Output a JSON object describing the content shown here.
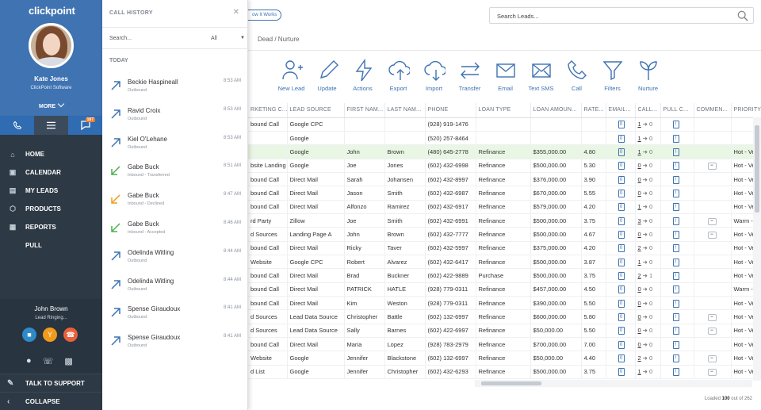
{
  "app": {
    "logo": "clickpoint"
  },
  "user": {
    "name": "Kate Jones",
    "company": "ClickPoint Software",
    "more_label": "MORE"
  },
  "tabs": {
    "leads_badge": "187"
  },
  "nav": [
    {
      "label": "HOME",
      "icon": "home-icon"
    },
    {
      "label": "CALENDAR",
      "icon": "calendar-icon"
    },
    {
      "label": "MY LEADS",
      "icon": "leads-icon"
    },
    {
      "label": "PRODUCTS",
      "icon": "products-icon"
    },
    {
      "label": "REPORTS",
      "icon": "reports-icon"
    },
    {
      "label": "PULL",
      "icon": "pull-icon"
    }
  ],
  "active_call": {
    "caller": "John Brown",
    "status": "Lead Ringing..."
  },
  "footer": {
    "support_label": "TALK TO SUPPORT",
    "collapse_label": "COLLAPSE"
  },
  "call_history": {
    "title": "CALL HISTORY",
    "search_placeholder": "Search...",
    "filter": "All",
    "section": "TODAY",
    "items": [
      {
        "name": "Beckie Haspineall",
        "status": "Outbound",
        "time": "8:53 AM",
        "type": "outbound"
      },
      {
        "name": "Ravid Croix",
        "status": "Outbound",
        "time": "8:53 AM",
        "type": "outbound"
      },
      {
        "name": "Kiel O'Lehane",
        "status": "Outbound",
        "time": "8:53 AM",
        "type": "outbound"
      },
      {
        "name": "Gabe Buck",
        "status": "Inbound - Transferred",
        "time": "8:51 AM",
        "type": "inbound-green"
      },
      {
        "name": "Gabe Buck",
        "status": "Inbound - Declined",
        "time": "8:47 AM",
        "type": "inbound-orange"
      },
      {
        "name": "Gabe Buck",
        "status": "Inbound - Accepted",
        "time": "8:46 AM",
        "type": "inbound-green"
      },
      {
        "name": "Odelinda Witling",
        "status": "Outbound",
        "time": "8:44 AM",
        "type": "outbound"
      },
      {
        "name": "Odelinda Witling",
        "status": "Outbound",
        "time": "8:44 AM",
        "type": "outbound"
      },
      {
        "name": "Spense Giraudoux",
        "status": "Outbound",
        "time": "8:41 AM",
        "type": "outbound"
      },
      {
        "name": "Spense Giraudoux",
        "status": "Outbound",
        "time": "8:41 AM",
        "type": "outbound"
      }
    ]
  },
  "header": {
    "how_it_works": "ow It Works",
    "search_placeholder": "Search Leads...",
    "breadcrumb": "Dead / Nurture"
  },
  "toolbar": [
    {
      "label": "New Lead",
      "icon": "new-lead-icon"
    },
    {
      "label": "Update",
      "icon": "update-icon"
    },
    {
      "label": "Actions",
      "icon": "actions-icon"
    },
    {
      "label": "Export",
      "icon": "export-icon"
    },
    {
      "label": "Import",
      "icon": "import-icon"
    },
    {
      "label": "Transfer",
      "icon": "transfer-icon"
    },
    {
      "label": "Email",
      "icon": "email-icon"
    },
    {
      "label": "Text SMS",
      "icon": "sms-icon"
    },
    {
      "label": "Call",
      "icon": "call-icon"
    },
    {
      "label": "Filters",
      "icon": "filters-icon"
    },
    {
      "label": "Nurture",
      "icon": "nurture-icon"
    }
  ],
  "table": {
    "columns": [
      "RKETING C...",
      "LEAD SOURCE",
      "FIRST NAM...",
      "LAST NAM...",
      "PHONE",
      "LOAN TYPE",
      "LOAN AMOUN...",
      "RATE...",
      "EMAIL...",
      "CALL...",
      "PULL C...",
      "COMMEN...",
      "PRIORITY..."
    ],
    "rows": [
      {
        "mkt": "bound Call",
        "src": "Google CPC",
        "first": "",
        "last": "",
        "phone": "(928) 919-1476",
        "type": "",
        "amount": "",
        "rate": "",
        "email": "0",
        "calls": "1",
        "calls_b": "0",
        "comment": false,
        "priority": ""
      },
      {
        "mkt": "",
        "src": "Google",
        "first": "",
        "last": "",
        "phone": "(520) 257-8464",
        "type": "",
        "amount": "",
        "rate": "",
        "email": "0",
        "calls": "1",
        "calls_b": "0",
        "comment": false,
        "priority": ""
      },
      {
        "mkt": "",
        "src": "Google",
        "first": "John",
        "last": "Brown",
        "phone": "(480) 645-2778",
        "type": "Refinance",
        "amount": "$355,000.00",
        "rate": "4.80",
        "email": "0",
        "calls": "1",
        "calls_b": "0",
        "comment": false,
        "priority": "Hot - Ve",
        "hl": true
      },
      {
        "mkt": "bsite Landing",
        "src": "Google",
        "first": "Joe",
        "last": "Jones",
        "phone": "(602) 432-6998",
        "type": "Refinance",
        "amount": "$500,000.00",
        "rate": "5.30",
        "email": "0",
        "calls": "0",
        "calls_b": "0",
        "comment": true,
        "priority": "Hot - Ve"
      },
      {
        "mkt": "bound Call",
        "src": "Direct Mail",
        "first": "Sarah",
        "last": "Johansen",
        "phone": "(602) 432-8997",
        "type": "Refinance",
        "amount": "$376,000.00",
        "rate": "3.90",
        "email": "0",
        "calls": "0",
        "calls_b": "0",
        "comment": false,
        "priority": "Hot - Ve"
      },
      {
        "mkt": "bound Call",
        "src": "Direct Mail",
        "first": "Jason",
        "last": "Smith",
        "phone": "(602) 432-6987",
        "type": "Refinance",
        "amount": "$670,000.00",
        "rate": "5.55",
        "email": "0",
        "calls": "0",
        "calls_b": "0",
        "comment": false,
        "priority": "Hot - Ve"
      },
      {
        "mkt": "bound Call",
        "src": "Direct Mail",
        "first": "Alfonzo",
        "last": "Ramirez",
        "phone": "(602) 432-6917",
        "type": "Refinance",
        "amount": "$579,000.00",
        "rate": "4.20",
        "email": "0",
        "calls": "1",
        "calls_b": "0",
        "comment": false,
        "priority": "Hot - Ve"
      },
      {
        "mkt": "rd Party",
        "src": "Zillow",
        "first": "Joe",
        "last": "Smith",
        "phone": "(602) 432-6991",
        "type": "Refinance",
        "amount": "$500,000.00",
        "rate": "3.75",
        "email": "0",
        "calls": "3",
        "calls_b": "0",
        "comment": true,
        "priority": "Warm -"
      },
      {
        "mkt": "d Sources",
        "src": "Landing Page A",
        "first": "John",
        "last": "Brown",
        "phone": "(602) 432-7777",
        "type": "Refinance",
        "amount": "$500,000.00",
        "rate": "4.67",
        "email": "0",
        "calls": "0",
        "calls_b": "0",
        "comment": true,
        "priority": "Hot - Ve"
      },
      {
        "mkt": "bound Call",
        "src": "Direct Mail",
        "first": "Ricky",
        "last": "Taver",
        "phone": "(602) 432-5997",
        "type": "Refinance",
        "amount": "$375,000.00",
        "rate": "4.20",
        "email": "0",
        "calls": "2",
        "calls_b": "0",
        "comment": false,
        "priority": "Hot - Ve"
      },
      {
        "mkt": "Website",
        "src": "Google CPC",
        "first": "Robert",
        "last": "Alvarez",
        "phone": "(602) 432-6417",
        "type": "Refinance",
        "amount": "$500,000.00",
        "rate": "3.87",
        "email": "0",
        "calls": "1",
        "calls_b": "0",
        "comment": false,
        "priority": "Hot - Ve"
      },
      {
        "mkt": "bound Call",
        "src": "Direct Mail",
        "first": "Brad",
        "last": "Buckner",
        "phone": "(602) 422-9889",
        "type": "Purchase",
        "amount": "$500,000.00",
        "rate": "3.75",
        "email": "0",
        "calls": "2",
        "calls_b": "1",
        "comment": false,
        "priority": "Hot - Ve"
      },
      {
        "mkt": "bound Call",
        "src": "Direct Mail",
        "first": "PATRICK",
        "last": "HATLE",
        "phone": "(928) 779-0311",
        "type": "Refinance",
        "amount": "$457,000.00",
        "rate": "4.50",
        "email": "0",
        "calls": "0",
        "calls_b": "0",
        "comment": false,
        "priority": "Warm -"
      },
      {
        "mkt": "bound Call",
        "src": "Direct Mail",
        "first": "Kim",
        "last": "Weston",
        "phone": "(928) 779-0311",
        "type": "Refinance",
        "amount": "$390,000.00",
        "rate": "5.50",
        "email": "0",
        "calls": "0",
        "calls_b": "0",
        "comment": false,
        "priority": "Hot - Ve"
      },
      {
        "mkt": "d Sources",
        "src": "Lead Data Source",
        "first": "Christopher",
        "last": "Battle",
        "phone": "(602) 132-6997",
        "type": "Refinance",
        "amount": "$600,000.00",
        "rate": "5.80",
        "email": "0",
        "calls": "0",
        "calls_b": "0",
        "comment": true,
        "priority": "Hot - Ve"
      },
      {
        "mkt": "d Sources",
        "src": "Lead Data Source",
        "first": "Sally",
        "last": "Barnes",
        "phone": "(602) 422-6997",
        "type": "Refinance",
        "amount": "$50,000.00",
        "rate": "5.50",
        "email": "0",
        "calls": "0",
        "calls_b": "0",
        "comment": true,
        "priority": "Hot - Ve"
      },
      {
        "mkt": "bound Call",
        "src": "Direct Mail",
        "first": "Maria",
        "last": "Lopez",
        "phone": "(928) 783-2979",
        "type": "Refinance",
        "amount": "$700,000.00",
        "rate": "7.00",
        "email": "0",
        "calls": "0",
        "calls_b": "0",
        "comment": false,
        "priority": "Hot - Ve"
      },
      {
        "mkt": "Website",
        "src": "Google",
        "first": "Jennifer",
        "last": "Blackstone",
        "phone": "(602) 132-6997",
        "type": "Refinance",
        "amount": "$50,000.00",
        "rate": "4.40",
        "email": "0",
        "calls": "2",
        "calls_b": "0",
        "comment": true,
        "priority": "Hot - Ve"
      },
      {
        "mkt": "d List",
        "src": "Google",
        "first": "Jennifer",
        "last": "Christopher",
        "phone": "(602) 432-6293",
        "type": "Refinance",
        "amount": "$500,000.00",
        "rate": "3.75",
        "email": "0",
        "calls": "1",
        "calls_b": "0",
        "comment": true,
        "priority": "Hot - Ve"
      }
    ]
  },
  "status": {
    "prefix": "Loaded",
    "loaded": "100",
    "middle": "out of",
    "total": "262"
  }
}
